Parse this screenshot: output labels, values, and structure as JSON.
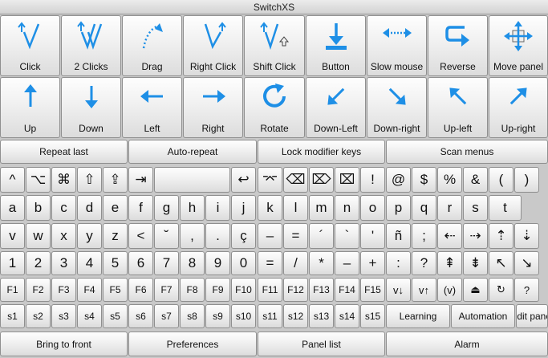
{
  "window": {
    "title": "SwitchXS"
  },
  "top_row": [
    {
      "label": "Click",
      "icon": "click-icon"
    },
    {
      "label": "2 Clicks",
      "icon": "double-click-icon"
    },
    {
      "label": "Drag",
      "icon": "drag-icon"
    },
    {
      "label": "Right Click",
      "icon": "right-click-icon"
    },
    {
      "label": "Shift Click",
      "icon": "shift-click-icon"
    },
    {
      "label": "Button",
      "icon": "button-down-icon"
    },
    {
      "label": "Slow mouse",
      "icon": "slow-mouse-icon"
    },
    {
      "label": "Reverse",
      "icon": "reverse-icon"
    },
    {
      "label": "Move panel",
      "icon": "move-panel-icon"
    }
  ],
  "dir_row": [
    {
      "label": "Up",
      "icon": "arrow-up-icon"
    },
    {
      "label": "Down",
      "icon": "arrow-down-icon"
    },
    {
      "label": "Left",
      "icon": "arrow-left-icon"
    },
    {
      "label": "Right",
      "icon": "arrow-right-icon"
    },
    {
      "label": "Rotate",
      "icon": "rotate-icon"
    },
    {
      "label": "Down-Left",
      "icon": "arrow-down-left-icon"
    },
    {
      "label": "Down-right",
      "icon": "arrow-down-right-icon"
    },
    {
      "label": "Up-left",
      "icon": "arrow-up-left-icon"
    },
    {
      "label": "Up-right",
      "icon": "arrow-up-right-icon"
    }
  ],
  "action_row": [
    "Repeat last",
    "Auto-repeat",
    "Lock modifier keys",
    "Scan menus"
  ],
  "key_rows": [
    [
      "^",
      "⌥",
      "⌘",
      "⇧",
      "⇪",
      "⇥",
      "",
      "↩",
      "⌤",
      "⌫",
      "⌦",
      "⌧",
      "!",
      "@",
      "$",
      "%",
      "&",
      "(",
      ")"
    ],
    [
      "a",
      "b",
      "c",
      "d",
      "e",
      "f",
      "g",
      "h",
      "i",
      "j",
      "k",
      "l",
      "m",
      "n",
      "o",
      "p",
      "q",
      "r",
      "s",
      "t"
    ],
    [
      "v",
      "w",
      "x",
      "y",
      "z",
      "<",
      "˘",
      ",",
      ".",
      "ç",
      "–",
      "=",
      "´",
      "`",
      "'",
      "ñ",
      ";",
      "⇠",
      "⇢",
      "⇡",
      "⇣"
    ],
    [
      "1",
      "2",
      "3",
      "4",
      "5",
      "6",
      "7",
      "8",
      "9",
      "0",
      "=",
      "/",
      "*",
      "–",
      "+",
      ":",
      "?",
      "⇞",
      "⇟",
      "↖",
      "↘"
    ],
    [
      "F1",
      "F2",
      "F3",
      "F4",
      "F5",
      "F6",
      "F7",
      "F8",
      "F9",
      "F10",
      "F11",
      "F12",
      "F13",
      "F14",
      "F15",
      "v↓",
      "v↑",
      "(v)",
      "⏏",
      "↻",
      "?"
    ],
    [
      "s1",
      "s2",
      "s3",
      "s4",
      "s5",
      "s6",
      "s7",
      "s8",
      "s9",
      "s10",
      "s11",
      "s12",
      "s13",
      "s14",
      "s15",
      "Learning",
      "Automation",
      "Edit panel"
    ]
  ],
  "bottom_row": [
    "Bring to front",
    "Preferences",
    "Panel list",
    "Alarm"
  ],
  "colors": {
    "icon_blue": "#1e8fe6"
  }
}
